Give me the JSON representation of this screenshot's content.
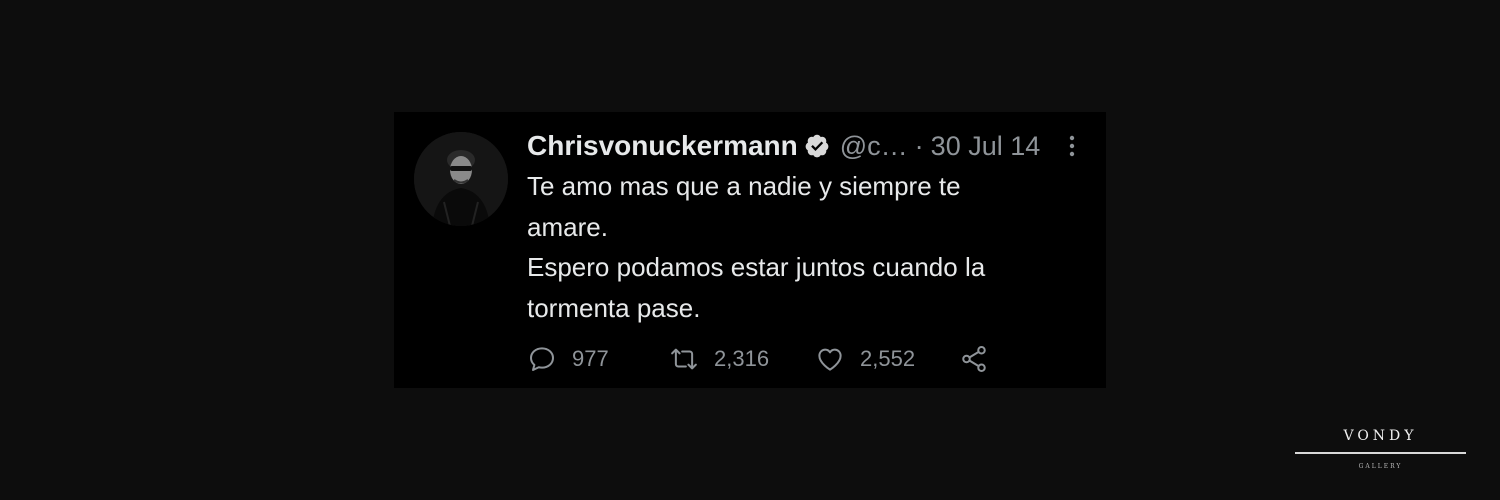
{
  "tweet": {
    "author_name": "Chrisvonuckermann",
    "handle": "@c…",
    "separator": "·",
    "date": "30 Jul 14",
    "text": "Te amo mas que a nadie y siempre te\namare.\nEspero podamos estar juntos cuando la\ntormenta pase.",
    "verified_icon": "verified-badge-icon",
    "more_icon": "more-vertical-icon",
    "avatar": "profile-photo"
  },
  "actions": {
    "reply": {
      "icon": "reply-icon",
      "count": "977"
    },
    "retweet": {
      "icon": "retweet-icon",
      "count": "2,316"
    },
    "like": {
      "icon": "heart-icon",
      "count": "2,552"
    },
    "share": {
      "icon": "share-icon"
    }
  },
  "watermark": {
    "title": "VONDY",
    "subtitle": "GALLERY"
  },
  "colors": {
    "background": "#0d0d0d",
    "card": "#000000",
    "text_primary": "#e7e9ea",
    "text_secondary": "#8f9499"
  }
}
